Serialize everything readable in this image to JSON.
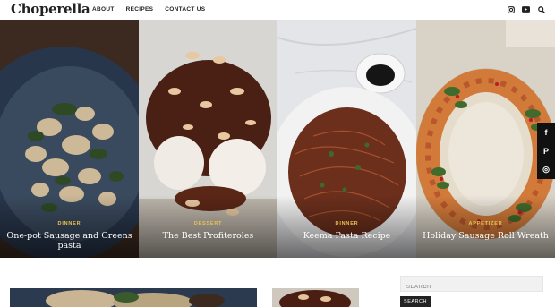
{
  "site": {
    "logo": "Choperella"
  },
  "nav": {
    "items": [
      "ABOUT",
      "RECIPES",
      "CONTACT US"
    ]
  },
  "header_icons": [
    "instagram-icon",
    "youtube-icon",
    "search-icon"
  ],
  "slides": [
    {
      "category": "DINNER",
      "title": "One-pot Sausage and Greens pasta"
    },
    {
      "category": "DESSERT",
      "title": "The Best Profiteroles"
    },
    {
      "category": "DINNER",
      "title": "Keema Pasta Recipe"
    },
    {
      "category": "APPETIZER",
      "title": "Holiday Sausage Roll Wreath"
    }
  ],
  "social": {
    "facebook": "f",
    "pinterest": "P",
    "instagram": "◎"
  },
  "sidebar": {
    "search_placeholder": "SEARCH",
    "search_button": "SEARCH"
  },
  "colors": {
    "accent": "#e9c04d",
    "dark": "#111111"
  }
}
